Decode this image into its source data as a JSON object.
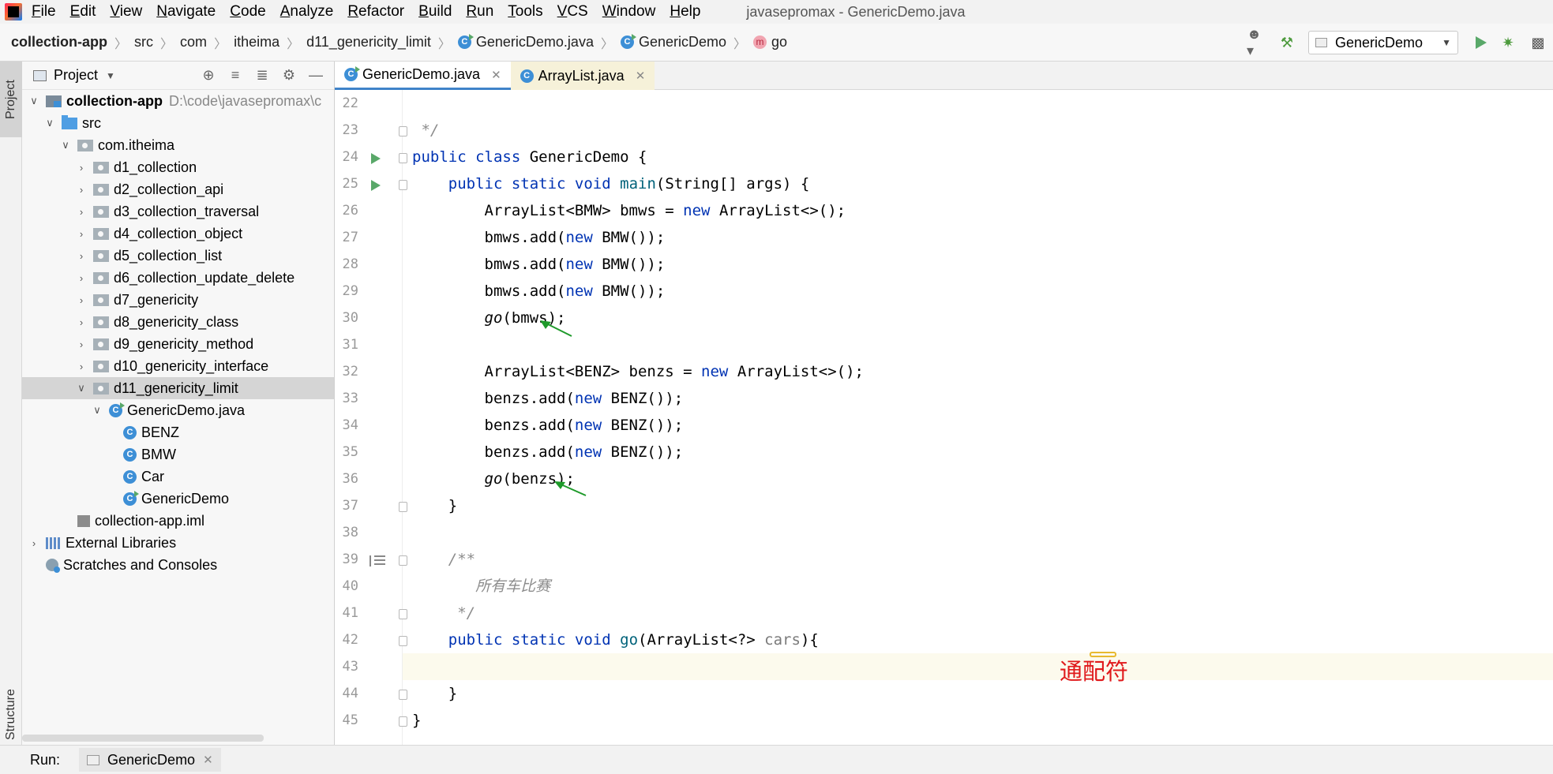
{
  "menu": {
    "items": [
      "File",
      "Edit",
      "View",
      "Navigate",
      "Code",
      "Analyze",
      "Refactor",
      "Build",
      "Run",
      "Tools",
      "VCS",
      "Window",
      "Help"
    ],
    "window_title": "javasepromax - GenericDemo.java"
  },
  "breadcrumb": {
    "items": [
      "collection-app",
      "src",
      "com",
      "itheima",
      "d11_genericity_limit",
      "GenericDemo.java",
      "GenericDemo",
      "go"
    ]
  },
  "toolbar": {
    "run_config": "GenericDemo"
  },
  "project_panel": {
    "title": "Project",
    "root_label": "collection-app",
    "root_path": "D:\\code\\javasepromax\\c",
    "src": "src",
    "package": "com.itheima",
    "folders": [
      "d1_collection",
      "d2_collection_api",
      "d3_collection_traversal",
      "d4_collection_object",
      "d5_collection_list",
      "d6_collection_update_delete",
      "d7_genericity",
      "d8_genericity_class",
      "d9_genericity_method",
      "d10_genericity_interface",
      "d11_genericity_limit"
    ],
    "file": "GenericDemo.java",
    "classes": [
      "BENZ",
      "BMW",
      "Car",
      "GenericDemo"
    ],
    "iml": "collection-app.iml",
    "external_libraries": "External Libraries",
    "scratches": "Scratches and Consoles"
  },
  "side_tabs": {
    "project": "Project",
    "structure": "Structure"
  },
  "editor": {
    "tabs": [
      "GenericDemo.java",
      "ArrayList.java"
    ],
    "line_numbers": [
      "22",
      "23",
      "24",
      "25",
      "26",
      "27",
      "28",
      "29",
      "30",
      "31",
      "32",
      "33",
      "34",
      "35",
      "36",
      "37",
      "38",
      "39",
      "40",
      "41",
      "42",
      "43",
      "44",
      "45"
    ],
    "annotation": "通配符"
  },
  "run_bar": {
    "label": "Run:",
    "tab": "GenericDemo"
  },
  "colors": {
    "keyword": "#0033b3",
    "comment": "#8c8c8c",
    "method_decl": "#00627a",
    "annotation_red": "#e0191b",
    "arrow_green": "#1e9a2a",
    "selection": "#d5d5d5"
  }
}
